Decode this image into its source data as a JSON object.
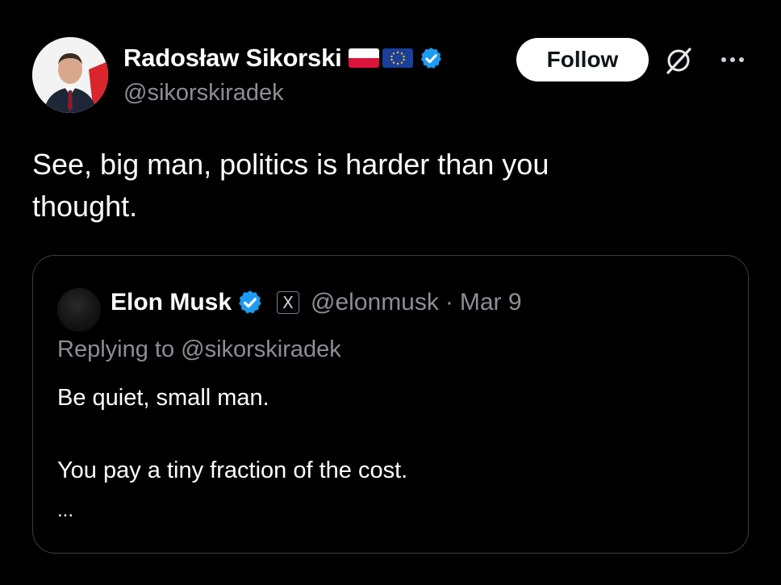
{
  "tweet": {
    "author": {
      "display_name": "Radosław Sikorski",
      "handle": "@sikorskiradek",
      "flags": [
        "poland-flag-icon",
        "eu-flag-icon"
      ],
      "verified_icon": "verified-badge-icon"
    },
    "follow_label": "Follow",
    "actions": [
      "grok-icon",
      "more-icon"
    ],
    "text_line1": "See, big man, politics is harder than you",
    "text_line2": "thought."
  },
  "quoted_tweet": {
    "author": {
      "display_name": "Elon Musk",
      "handle": "@elonmusk",
      "affiliate_badge": "X",
      "verified_icon": "verified-badge-icon"
    },
    "separator": "·",
    "date": "Mar 9",
    "replying_to": "Replying to @sikorskiradek",
    "line1": "Be quiet, small man.",
    "line2": "You pay a tiny fraction of the cost.",
    "ellipsis": "..."
  },
  "colors": {
    "background": "#000000",
    "primary_text": "#ffffff",
    "secondary_text": "#8b8f94",
    "verified_blue": "#1d9bf0",
    "card_border": "#3a3d41"
  }
}
